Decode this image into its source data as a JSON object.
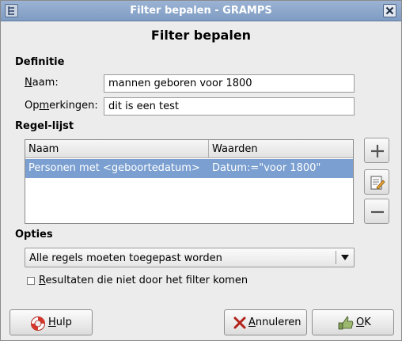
{
  "window": {
    "title": "Filter bepalen - GRAMPS",
    "heading": "Filter bepalen"
  },
  "definition": {
    "section_label": "Definitie",
    "name_label_mnemonic": "N",
    "name_label_rest": "aam:",
    "name_value": "mannen geboren voor 1800",
    "comment_label_pre": "Op",
    "comment_label_mnemonic": "m",
    "comment_label_post": "erkingen:",
    "comment_value": "dit is een test"
  },
  "rules": {
    "section_label": "Regel-lijst",
    "columns": [
      "Naam",
      "Waarden"
    ],
    "rows": [
      {
        "name": "Personen met <geboortedatum>",
        "value": "Datum:=\"voor 1800\"",
        "selected": true
      }
    ],
    "buttons": [
      {
        "name": "add-rule-button",
        "icon": "plus-icon"
      },
      {
        "name": "edit-rule-button",
        "icon": "edit-icon"
      },
      {
        "name": "remove-rule-button",
        "icon": "minus-icon"
      }
    ]
  },
  "options": {
    "section_label": "Opties",
    "selected_option": "Alle regels moeten toegepast worden",
    "invert_mnemonic": "R",
    "invert_label_rest": "esultaten die niet door het filter komen",
    "invert_checked": false
  },
  "footer": {
    "help_mnemonic": "H",
    "help_rest": "ulp",
    "cancel_mnemonic": "A",
    "cancel_rest": "nnuleren",
    "ok_mnemonic": "O",
    "ok_rest": "K"
  },
  "colors": {
    "titlebar": "#8aa6cb",
    "selection": "#7a9fd0",
    "dialog_bg": "#ececec"
  }
}
